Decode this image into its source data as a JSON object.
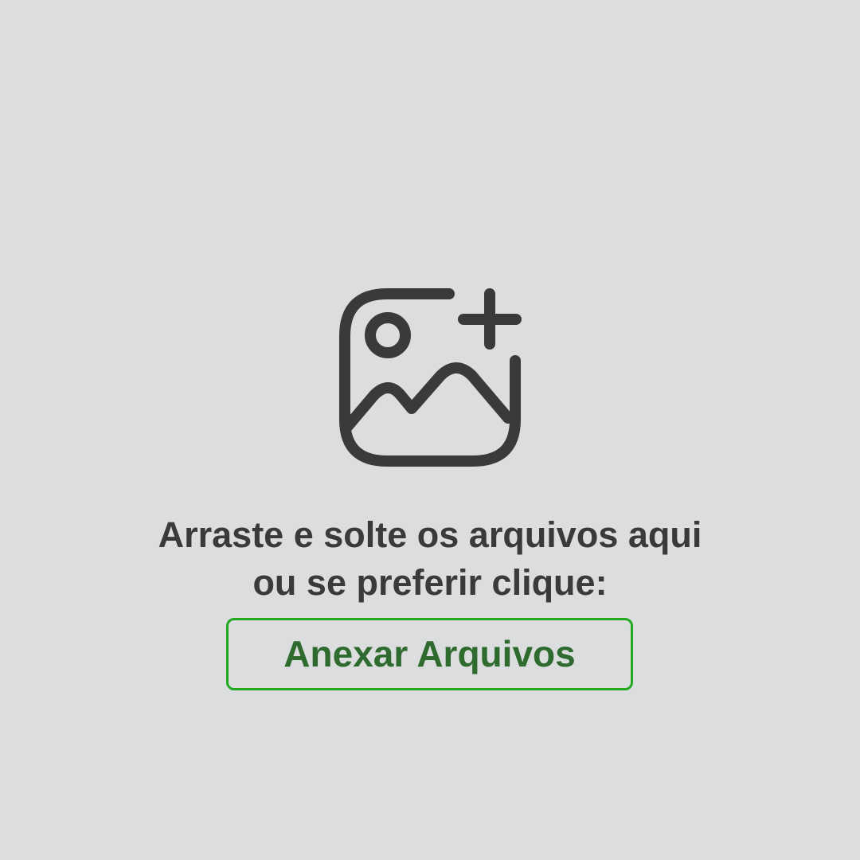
{
  "dropzone": {
    "icon": "add-image-icon",
    "instruction_line1": "Arraste e solte os arquivos aqui",
    "instruction_line2": "ou se preferir clique:",
    "button_label": "Anexar Arquivos"
  },
  "colors": {
    "background": "#dcdddf",
    "icon_stroke": "#393a3b",
    "text": "#393a3b",
    "button_border": "#21aa21",
    "button_text": "#2f6b2f"
  }
}
